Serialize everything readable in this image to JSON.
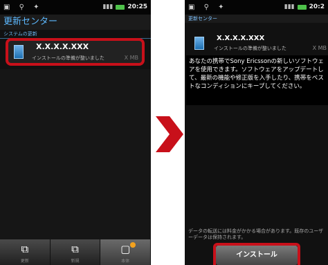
{
  "left_screen": {
    "status_time": "20:25",
    "title": "更新センター",
    "subtitle": "システムの更新",
    "item": {
      "name": "X.X.X.X.XXX",
      "description": "インストールの準備が整いました",
      "size": "X MB"
    },
    "nav": [
      {
        "label": "更新",
        "icon": "update-icon",
        "active": false
      },
      {
        "label": "新規",
        "icon": "new-icon",
        "active": false
      },
      {
        "label": "本体",
        "icon": "device-icon",
        "active": true
      }
    ]
  },
  "right_screen": {
    "status_time": "20:2",
    "title": "更新センター",
    "item": {
      "name": "X.X.X.X.XXX",
      "description": "インストールの準備が整いました",
      "size": "X MB"
    },
    "body_text": "あなたの携帯でSony Ericssonの新しいソフトウェアを使用できます。ソフトウェアをアップデートして、最新の機能や修正版を入手したり、携帯をベストなコンディションにキープしてください。",
    "note_text": "データの転送には料金がかかる場合があります。既存のユーザーデータは保持されます。",
    "install_button": "インストール"
  },
  "colors": {
    "highlight": "#c8101a",
    "title_blue": "#5db9ff",
    "arrow": "#c8101a"
  }
}
